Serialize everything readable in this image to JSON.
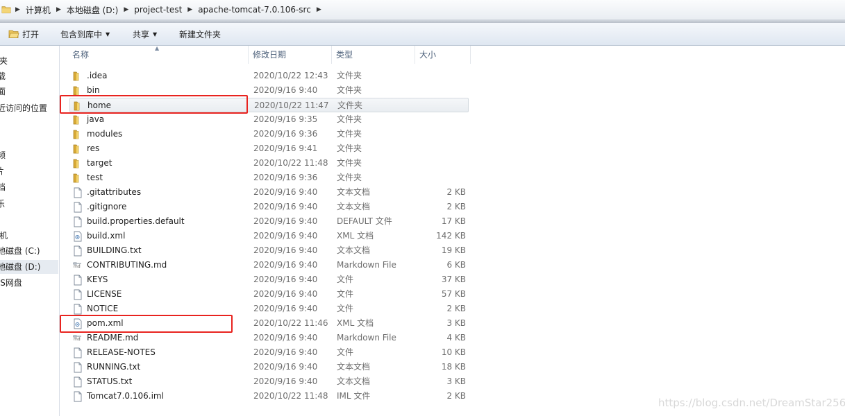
{
  "address_bar": {
    "crumbs": [
      "计算机",
      "本地磁盘 (D:)",
      "project-test",
      "apache-tomcat-7.0.106-src"
    ]
  },
  "toolbar": {
    "open_label": "打开",
    "include_label": "包含到库中",
    "share_label": "共享",
    "new_folder_label": "新建文件夹"
  },
  "nav": {
    "items": [
      {
        "label": "夹"
      },
      {
        "label": "载"
      },
      {
        "label": "面"
      },
      {
        "label": "近访问的位置"
      },
      {
        "label": "频"
      },
      {
        "label": "片"
      },
      {
        "label": "档"
      },
      {
        "label": "乐"
      },
      {
        "label": "机"
      },
      {
        "label": "地磁盘 (C:)"
      },
      {
        "label": "地磁盘 (D:)"
      },
      {
        "label": "PS网盘"
      }
    ]
  },
  "headers": {
    "name": "名称",
    "date": "修改日期",
    "type": "类型",
    "size": "大小"
  },
  "files": [
    {
      "name": ".idea",
      "date": "2020/10/22 12:43",
      "type": "文件夹",
      "size": "",
      "icon": "folder-icon"
    },
    {
      "name": "bin",
      "date": "2020/9/16 9:40",
      "type": "文件夹",
      "size": "",
      "icon": "folder-icon"
    },
    {
      "name": "home",
      "date": "2020/10/22 11:47",
      "type": "文件夹",
      "size": "",
      "icon": "folder-icon"
    },
    {
      "name": "java",
      "date": "2020/9/16 9:35",
      "type": "文件夹",
      "size": "",
      "icon": "folder-icon"
    },
    {
      "name": "modules",
      "date": "2020/9/16 9:36",
      "type": "文件夹",
      "size": "",
      "icon": "folder-icon"
    },
    {
      "name": "res",
      "date": "2020/9/16 9:41",
      "type": "文件夹",
      "size": "",
      "icon": "folder-icon"
    },
    {
      "name": "target",
      "date": "2020/10/22 11:48",
      "type": "文件夹",
      "size": "",
      "icon": "folder-icon"
    },
    {
      "name": "test",
      "date": "2020/9/16 9:36",
      "type": "文件夹",
      "size": "",
      "icon": "folder-icon"
    },
    {
      "name": ".gitattributes",
      "date": "2020/9/16 9:40",
      "type": "文本文档",
      "size": "2 KB",
      "icon": "document-icon"
    },
    {
      "name": ".gitignore",
      "date": "2020/9/16 9:40",
      "type": "文本文档",
      "size": "2 KB",
      "icon": "document-icon"
    },
    {
      "name": "build.properties.default",
      "date": "2020/9/16 9:40",
      "type": "DEFAULT 文件",
      "size": "17 KB",
      "icon": "document-icon"
    },
    {
      "name": "build.xml",
      "date": "2020/9/16 9:40",
      "type": "XML 文档",
      "size": "142 KB",
      "icon": "xml-file-icon"
    },
    {
      "name": "BUILDING.txt",
      "date": "2020/9/16 9:40",
      "type": "文本文档",
      "size": "19 KB",
      "icon": "document-icon"
    },
    {
      "name": "CONTRIBUTING.md",
      "date": "2020/9/16 9:40",
      "type": "Markdown File",
      "size": "6 KB",
      "icon": "markdown-file-icon"
    },
    {
      "name": "KEYS",
      "date": "2020/9/16 9:40",
      "type": "文件",
      "size": "37 KB",
      "icon": "document-icon"
    },
    {
      "name": "LICENSE",
      "date": "2020/9/16 9:40",
      "type": "文件",
      "size": "57 KB",
      "icon": "document-icon"
    },
    {
      "name": "NOTICE",
      "date": "2020/9/16 9:40",
      "type": "文件",
      "size": "2 KB",
      "icon": "document-icon"
    },
    {
      "name": "pom.xml",
      "date": "2020/10/22 11:46",
      "type": "XML 文档",
      "size": "3 KB",
      "icon": "xml-file-icon"
    },
    {
      "name": "README.md",
      "date": "2020/9/16 9:40",
      "type": "Markdown File",
      "size": "4 KB",
      "icon": "markdown-file-icon"
    },
    {
      "name": "RELEASE-NOTES",
      "date": "2020/9/16 9:40",
      "type": "文件",
      "size": "10 KB",
      "icon": "document-icon"
    },
    {
      "name": "RUNNING.txt",
      "date": "2020/9/16 9:40",
      "type": "文本文档",
      "size": "18 KB",
      "icon": "document-icon"
    },
    {
      "name": "STATUS.txt",
      "date": "2020/9/16 9:40",
      "type": "文本文档",
      "size": "3 KB",
      "icon": "document-icon"
    },
    {
      "name": "Tomcat7.0.106.iml",
      "date": "2020/10/22 11:48",
      "type": "IML 文件",
      "size": "2 KB",
      "icon": "document-icon"
    }
  ],
  "watermark": "https://blog.csdn.net/DreamStar2560",
  "colors": {
    "highlight": "#e8231f",
    "folder": "#e8c25a",
    "header_text": "#4c607a"
  }
}
